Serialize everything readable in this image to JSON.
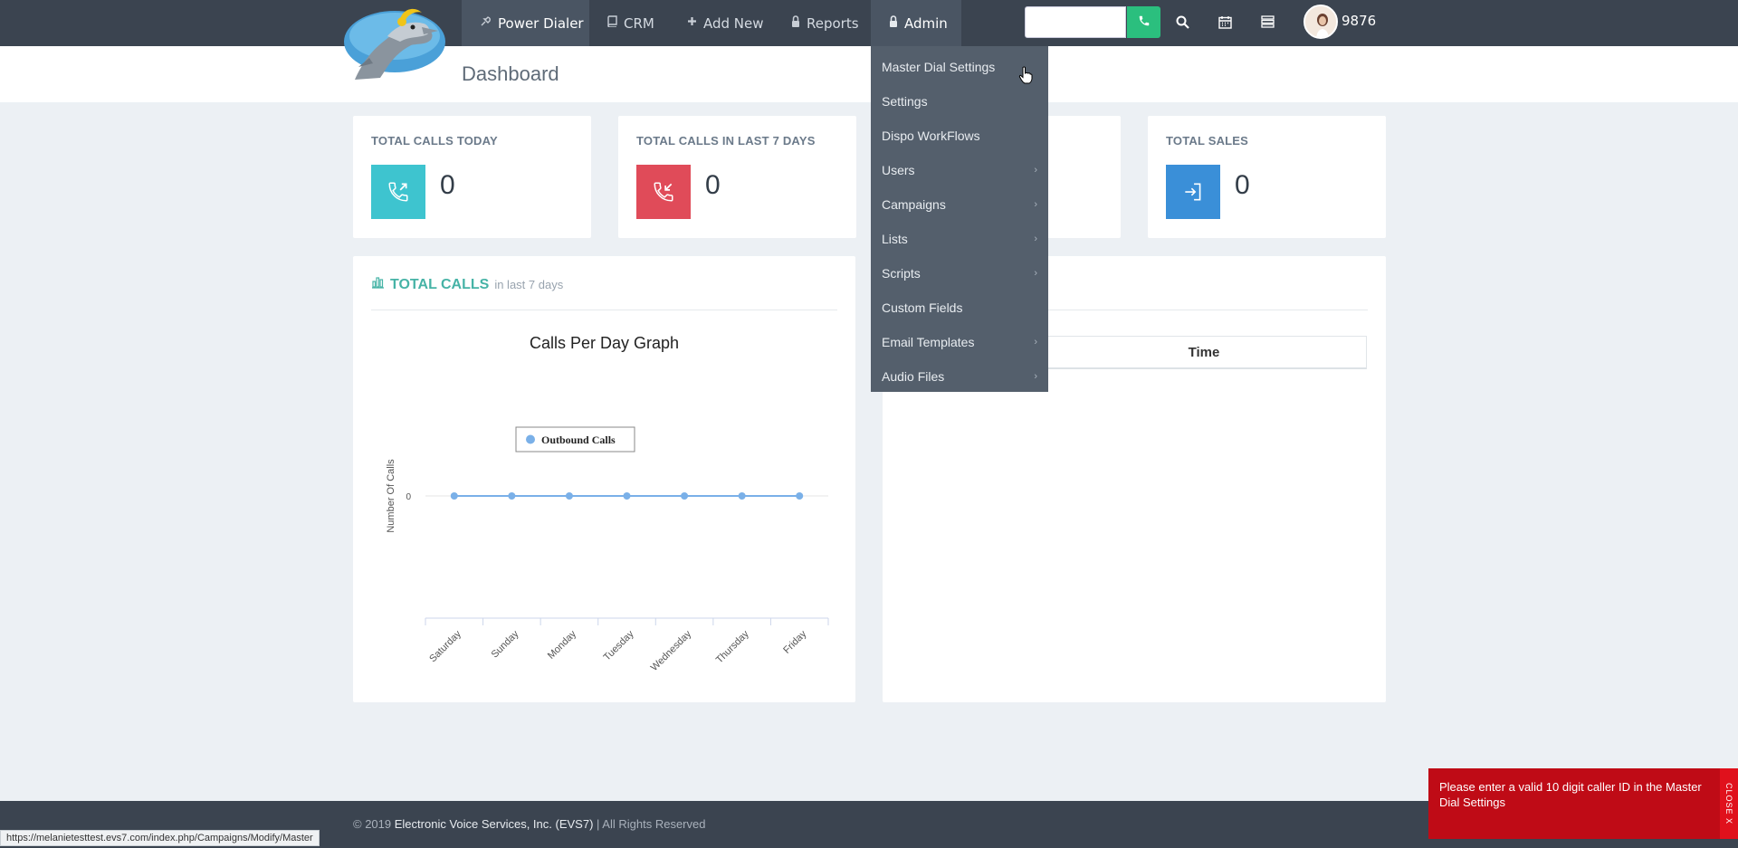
{
  "nav": {
    "items": [
      {
        "label": "Power Dialer",
        "icon": "power-dialer-icon"
      },
      {
        "label": "CRM",
        "icon": "book-icon"
      },
      {
        "label": "Add New",
        "icon": "plus-icon"
      },
      {
        "label": "Reports",
        "icon": "reports-icon"
      },
      {
        "label": "Admin",
        "icon": "lock-icon"
      }
    ],
    "search": {
      "placeholder": "",
      "value": ""
    },
    "user_id": "9876"
  },
  "page_title": "Dashboard",
  "stats": [
    {
      "label": "TOTAL CALLS TODAY",
      "value": "0",
      "color": "#3ec4cf"
    },
    {
      "label": "TOTAL CALLS IN LAST 7 DAYS",
      "value": "0",
      "color": "#e04b59"
    },
    {
      "label": "",
      "value": "",
      "color": ""
    },
    {
      "label": "TOTAL SALES",
      "value": "0",
      "color": "#3a8fd8"
    }
  ],
  "calls_panel": {
    "title": "TOTAL CALLS",
    "subtitle": "in last 7 days"
  },
  "chart_data": {
    "type": "line",
    "title": "Calls Per Day Graph",
    "ylabel": "Number Of Calls",
    "xlabel": "",
    "categories": [
      "Saturday",
      "Sunday",
      "Monday",
      "Tuesday",
      "Wednesday",
      "Thursday",
      "Friday"
    ],
    "series": [
      {
        "name": "Outbound Calls",
        "values": [
          0,
          0,
          0,
          0,
          0,
          0,
          0
        ],
        "color": "#7ab0e8"
      }
    ],
    "y_ticks": [
      "0"
    ],
    "legend": "top-center",
    "grid": true
  },
  "right_panel": {
    "time_header": "Time"
  },
  "admin_menu": [
    {
      "label": "Master Dial Settings",
      "submenu": false
    },
    {
      "label": "Settings",
      "submenu": false
    },
    {
      "label": "Dispo WorkFlows",
      "submenu": false
    },
    {
      "label": "Users",
      "submenu": true
    },
    {
      "label": "Campaigns",
      "submenu": true
    },
    {
      "label": "Lists",
      "submenu": true
    },
    {
      "label": "Scripts",
      "submenu": true
    },
    {
      "label": "Custom Fields",
      "submenu": false
    },
    {
      "label": "Email Templates",
      "submenu": true
    },
    {
      "label": "Audio Files",
      "submenu": true
    }
  ],
  "footer": {
    "prefix": "© 2019",
    "company": "Electronic Voice Services, Inc. (EVS7)",
    "suffix": "| All Rights Reserved"
  },
  "status_url": "https://melanietesttest.evs7.com/index.php/Campaigns/Modify/Master",
  "toast": {
    "message": "Please enter a valid 10 digit caller ID in the Master Dial Settings",
    "close_label": "CLOSE X"
  }
}
